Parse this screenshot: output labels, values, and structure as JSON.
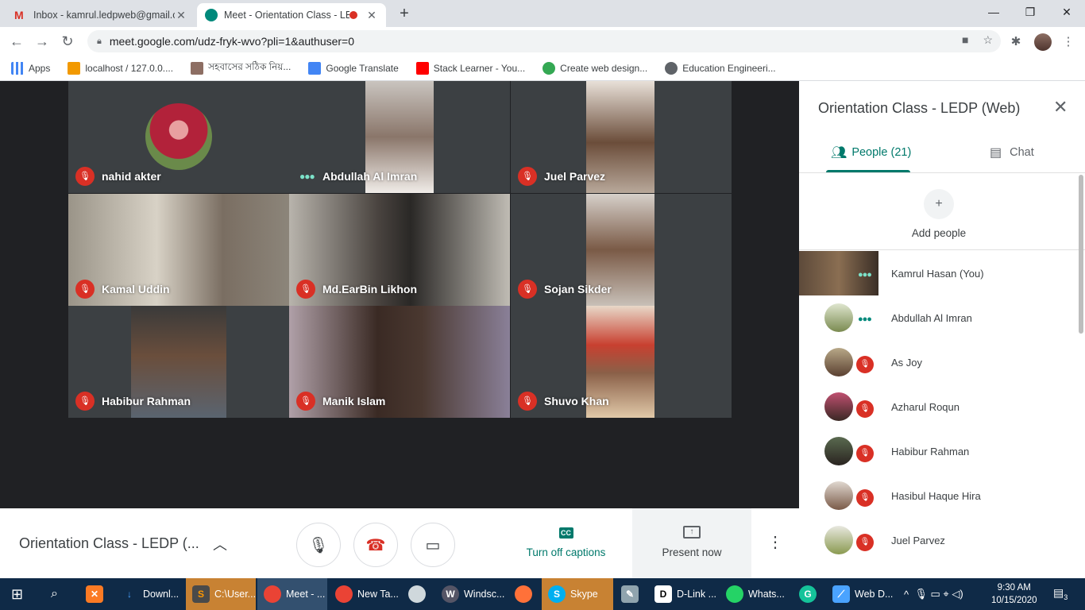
{
  "browser": {
    "tabs": [
      {
        "title": "Inbox - kamrul.ledpweb@gmail.c",
        "close": "✕"
      },
      {
        "title": "Meet - Orientation Class - LE",
        "close": "✕"
      }
    ],
    "new_tab": "+",
    "window_controls": [
      "—",
      "❐",
      "✕"
    ],
    "url": "meet.google.com/udz-fryk-wvo?pli=1&authuser=0",
    "bookmarks": [
      {
        "label": "Apps",
        "color": "#4285f4"
      },
      {
        "label": "localhost / 127.0.0....",
        "color": "#f29900"
      },
      {
        "label": "সহবাসের সঠিক নিয়...",
        "color": "#8d6e63"
      },
      {
        "label": "Google Translate",
        "color": "#4285f4"
      },
      {
        "label": "Stack Learner - You...",
        "color": "#ff0000"
      },
      {
        "label": "Create web design...",
        "color": "#34a853"
      },
      {
        "label": "Education Engineeri...",
        "color": "#5f6368"
      }
    ]
  },
  "meet": {
    "participants_grid": [
      {
        "name": "nahid akter",
        "state": "muted"
      },
      {
        "name": "Abdullah Al Imran",
        "state": "speaking"
      },
      {
        "name": "Juel Parvez",
        "state": "muted"
      },
      {
        "name": "Kamal Uddin",
        "state": "muted"
      },
      {
        "name": "Md.EarBin Likhon",
        "state": "muted"
      },
      {
        "name": "Sojan Sikder",
        "state": "muted"
      },
      {
        "name": "Habibur Rahman",
        "state": "muted"
      },
      {
        "name": "Manik Islam",
        "state": "muted"
      },
      {
        "name": "Shuvo Khan",
        "state": "muted"
      }
    ],
    "bottom": {
      "meeting_name": "Orientation Class - LEDP (...",
      "captions_label": "Turn off captions",
      "present_label": "Present now"
    },
    "panel": {
      "title": "Orientation Class - LEDP (Web)",
      "people_tab": "People (21)",
      "chat_tab": "Chat",
      "add_people": "Add people",
      "people": [
        {
          "name": "Kamrul Hasan (You)",
          "state": "speaking"
        },
        {
          "name": "Abdullah Al Imran",
          "state": "speaking"
        },
        {
          "name": "As Joy",
          "state": "muted"
        },
        {
          "name": "Azharul Roqun",
          "state": "muted"
        },
        {
          "name": "Habibur Rahman",
          "state": "muted"
        },
        {
          "name": "Hasibul Haque Hira",
          "state": "muted"
        },
        {
          "name": "Juel Parvez",
          "state": "muted"
        }
      ]
    }
  },
  "taskbar": {
    "items": [
      {
        "label": "",
        "icon": "xampp-icon"
      },
      {
        "label": "Downl...",
        "icon": "download-icon"
      },
      {
        "label": "C:\\User...",
        "icon": "sublime-icon"
      },
      {
        "label": "Meet - ...",
        "icon": "chrome-icon"
      },
      {
        "label": "New Ta...",
        "icon": "chrome-icon"
      },
      {
        "label": "",
        "icon": "app-icon"
      },
      {
        "label": "Windsc...",
        "icon": "windscribe-icon"
      },
      {
        "label": "",
        "icon": "firefox-icon"
      },
      {
        "label": "Skype",
        "icon": "skype-icon"
      },
      {
        "label": "",
        "icon": "paint-icon"
      },
      {
        "label": "D-Link ...",
        "icon": "dlink-icon"
      },
      {
        "label": "Whats...",
        "icon": "whatsapp-icon"
      },
      {
        "label": "",
        "icon": "grammarly-icon"
      },
      {
        "label": "Web D...",
        "icon": "webd-icon"
      }
    ],
    "time": "9:30 AM",
    "date": "10/15/2020",
    "notifications": "3"
  }
}
